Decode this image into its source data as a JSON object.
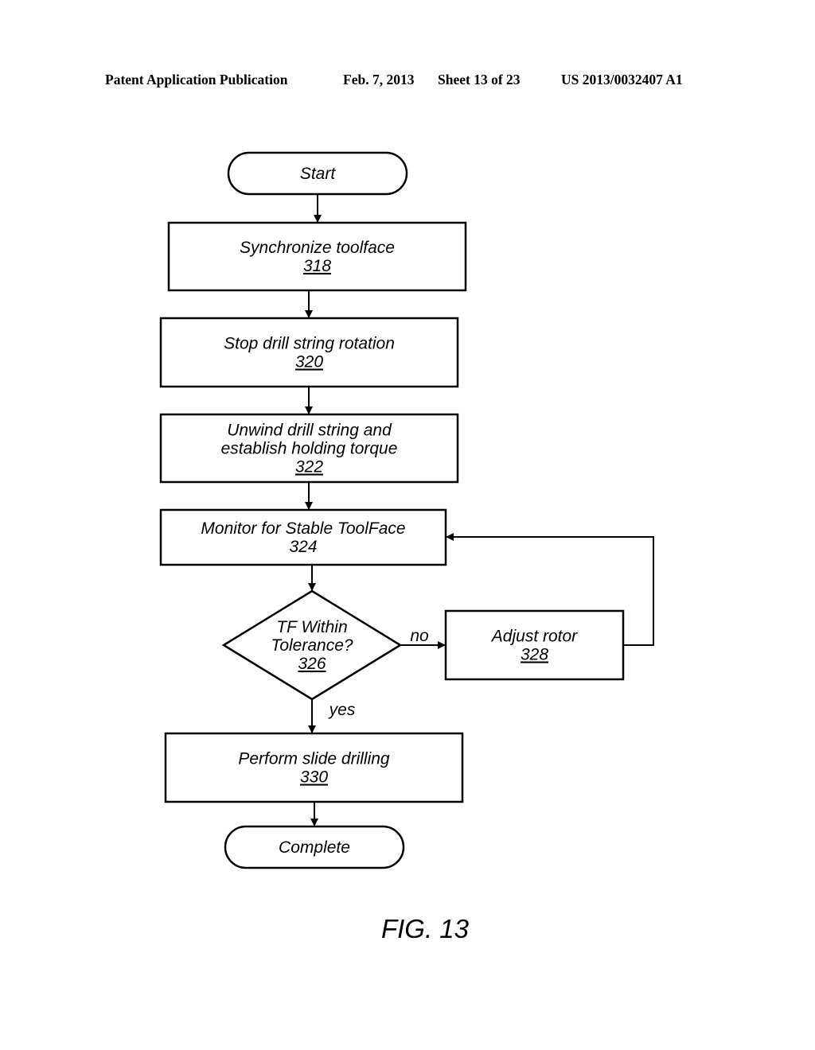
{
  "header": {
    "publication": "Patent Application Publication",
    "date": "Feb. 7, 2013",
    "sheet": "Sheet 13 of 23",
    "number": "US 2013/0032407 A1"
  },
  "figure_label": "FIG. 13",
  "nodes": {
    "start": {
      "type": "terminator",
      "lines": [
        "Start"
      ]
    },
    "n318": {
      "type": "process",
      "lines": [
        "Synchronize toolface"
      ],
      "ref": "318",
      "ref_underlined": true
    },
    "n320": {
      "type": "process",
      "lines": [
        "Stop drill string rotation"
      ],
      "ref": "320",
      "ref_underlined": true
    },
    "n322": {
      "type": "process",
      "lines": [
        "Unwind drill string  and",
        "establish holding torque"
      ],
      "ref": "322",
      "ref_underlined": true
    },
    "n324": {
      "type": "process",
      "lines": [
        "Monitor for Stable ToolFace"
      ],
      "ref": "324",
      "ref_underlined": false
    },
    "n326": {
      "type": "decision",
      "lines": [
        "TF Within",
        "Tolerance?"
      ],
      "ref": "326",
      "ref_underlined": true
    },
    "n328": {
      "type": "process",
      "lines": [
        "Adjust rotor"
      ],
      "ref": "328",
      "ref_underlined": true
    },
    "n330": {
      "type": "process",
      "lines": [
        "Perform slide drilling"
      ],
      "ref": "330",
      "ref_underlined": true
    },
    "complete": {
      "type": "terminator",
      "lines": [
        "Complete"
      ]
    }
  },
  "edges": [
    {
      "from": "start",
      "to": "n318",
      "label": ""
    },
    {
      "from": "n318",
      "to": "n320",
      "label": ""
    },
    {
      "from": "n320",
      "to": "n322",
      "label": ""
    },
    {
      "from": "n322",
      "to": "n324",
      "label": ""
    },
    {
      "from": "n324",
      "to": "n326",
      "label": ""
    },
    {
      "from": "n326",
      "to": "n328",
      "label": "no"
    },
    {
      "from": "n328",
      "to": "n324",
      "label": ""
    },
    {
      "from": "n326",
      "to": "n330",
      "label": "yes"
    },
    {
      "from": "n330",
      "to": "complete",
      "label": ""
    }
  ]
}
